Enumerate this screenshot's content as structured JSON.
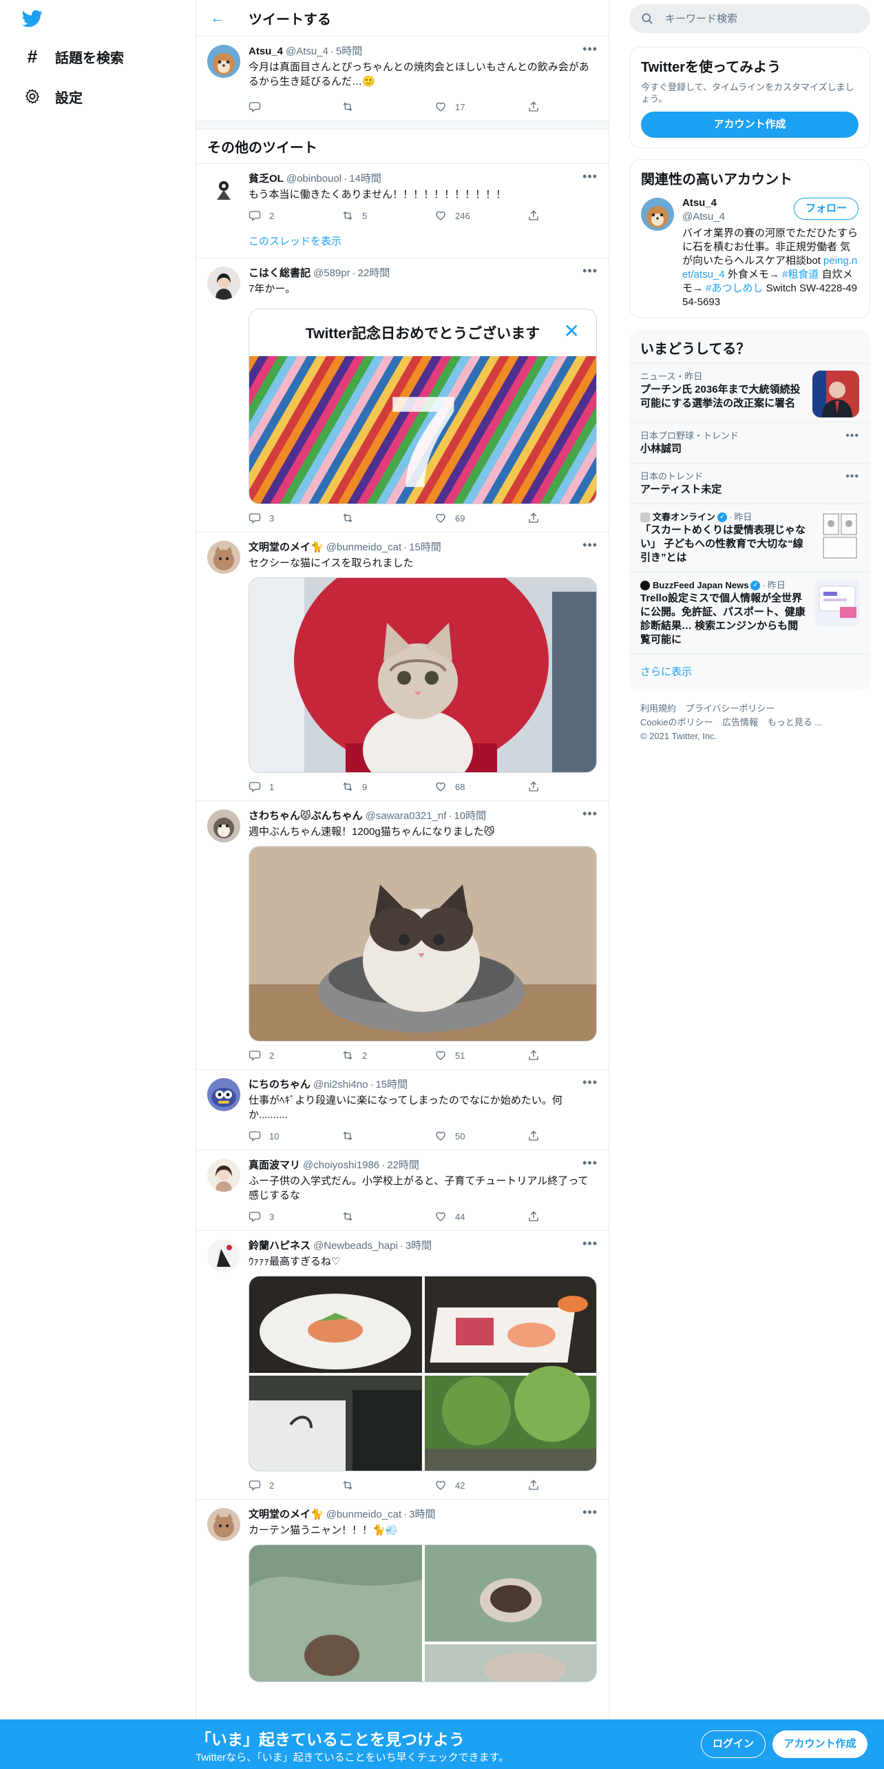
{
  "nav": {
    "explore_label": "話題を検索",
    "settings_label": "設定"
  },
  "header": {
    "title": "ツイートする"
  },
  "main_tweet": {
    "name": "Atsu_4",
    "handle": "@Atsu_4",
    "time": "5時間",
    "text": "今月は真面目さんとぴっちゃんとの焼肉会とほしいもさんとの飲み会があるから生き延びるんだ…🙂",
    "replies": "",
    "retweets": "",
    "likes": "17"
  },
  "section_title": "その他のツイート",
  "tweets": [
    {
      "name": "貧乏OL",
      "handle": "@obinbouol",
      "time": "14時間",
      "text": "もう本当に働きたくありません！！！！！！！！！！！",
      "replies": "2",
      "retweets": "5",
      "likes": "246",
      "thread_link": "このスレッドを表示"
    },
    {
      "name": "こはく総書記",
      "handle": "@589pr",
      "time": "22時間",
      "text": "7年かー。",
      "card_title": "Twitter記念日おめでとうございます",
      "card_number": "7",
      "replies": "3",
      "retweets": "",
      "likes": "69"
    },
    {
      "name": "文明堂のメイ🐈",
      "handle": "@bunmeido_cat",
      "time": "15時間",
      "text": "セクシーな猫にイスを取られました",
      "replies": "1",
      "retweets": "9",
      "likes": "68"
    },
    {
      "name": "さわちゃん😾ぶんちゃん",
      "handle": "@sawara0321_nf",
      "time": "10時間",
      "text": "週中ぶんちゃん速報！1200g猫ちゃんになりました😼",
      "replies": "2",
      "retweets": "2",
      "likes": "51"
    },
    {
      "name": "にちのちゃん",
      "handle": "@ni2shi4no",
      "time": "15時間",
      "text": "仕事がﾍｷﾞより段違いに楽になってしまったのでなにか始めたい。何か..........",
      "replies": "10",
      "retweets": "",
      "likes": "50"
    },
    {
      "name": "真面波マリ",
      "handle": "@choiyoshi1986",
      "time": "22時間",
      "text": "ふー子供の入学式だん。小学校上がると、子育てチュートリアル終了って感じするな",
      "replies": "3",
      "retweets": "",
      "likes": "44"
    },
    {
      "name": "鈴蘭ハピネス",
      "handle": "@Newbeads_hapi",
      "time": "3時間",
      "text": "ｳｧｧｧ最高すぎるね♡",
      "replies": "2",
      "retweets": "",
      "likes": "42"
    },
    {
      "name": "文明堂のメイ🐈",
      "handle": "@bunmeido_cat",
      "time": "3時間",
      "text": "カーテン猫うニャン！！！🐈💨"
    }
  ],
  "search": {
    "placeholder": "キーワード検索"
  },
  "signup_panel": {
    "title": "Twitterを使ってみよう",
    "desc": "今すぐ登録して、タイムラインをカスタマイズしましょう。",
    "button": "アカウント作成"
  },
  "related": {
    "title": "関連性の高いアカウント",
    "name": "Atsu_4",
    "handle": "@Atsu_4",
    "follow": "フォロー",
    "bio1": "バイオ業界の賽の河原でただひたすらに石を積むお仕事。非正規労働者 気が向いたらヘルスケア相談bot",
    "bio_link": "peing.net/atsu_4",
    "bio2": " 外食メモ→ ",
    "tag1": "#粗食道",
    "bio3": " 自炊メモ→ ",
    "tag2": "#あつしめし",
    "bio4": " Switch SW-4228-4954-5693"
  },
  "trends": {
    "title": "いまどうしてる？",
    "items": [
      {
        "meta": "ニュース・昨日",
        "title": "プーチン氏 2036年まで大統領続投可能にする選挙法の改正案に署名"
      },
      {
        "meta": "日本プロ野球・トレンド",
        "title": "小林誠司"
      },
      {
        "meta": "日本のトレンド",
        "title": "アーティスト未定"
      },
      {
        "source": "文春オンライン",
        "meta": "昨日",
        "title": "「スカートめくりは愛情表現じゃない」 子どもへの性教育で大切な“線引き”とは"
      },
      {
        "source": "BuzzFeed Japan News",
        "meta": "昨日",
        "title": "Trello設定ミスで個人情報が全世界に公開。免許証、パスポート、健康診断結果… 検索エンジンからも閲覧可能に"
      }
    ],
    "show_more": "さらに表示"
  },
  "footer": {
    "links": [
      "利用規約",
      "プライバシーポリシー",
      "Cookieのポリシー",
      "広告情報",
      "もっと見る ..."
    ],
    "copyright": "© 2021 Twitter, Inc."
  },
  "bottom_bar": {
    "title": "「いま」起きていることを見つけよう",
    "subtitle": "Twitterなら、「いま」起きていることをいち早くチェックできます。",
    "login": "ログイン",
    "signup": "アカウント作成"
  },
  "colors": {
    "accent": "#1da1f2",
    "text": "#0f1419",
    "muted": "#5b7083",
    "border": "#e6ecf0"
  }
}
